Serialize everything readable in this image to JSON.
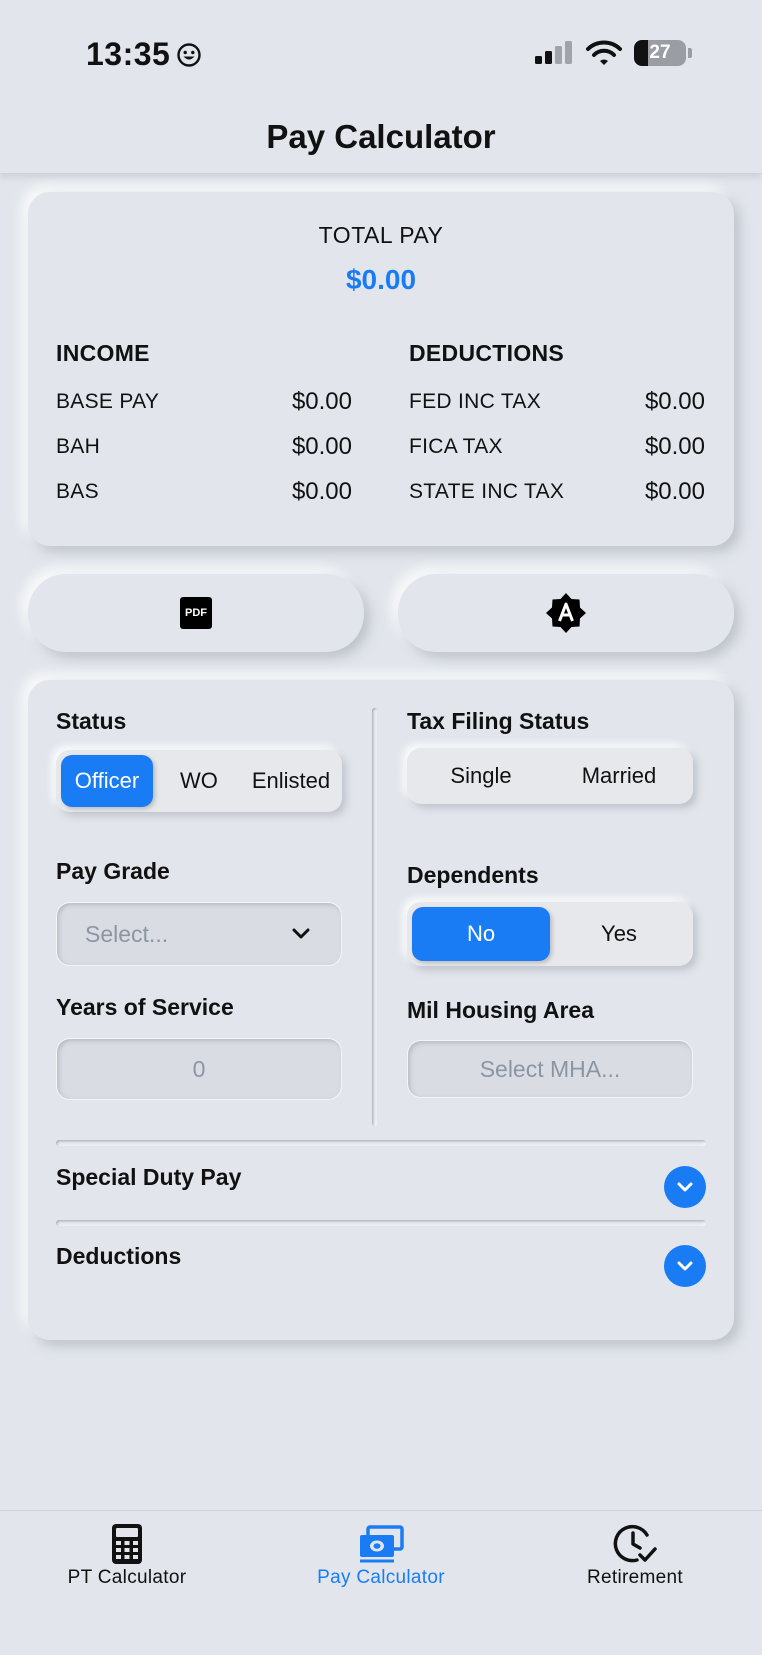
{
  "status_bar": {
    "time": "13:35",
    "battery": "27"
  },
  "header": {
    "title": "Pay Calculator"
  },
  "summary": {
    "total_label": "TOTAL PAY",
    "total_value": "$0.00",
    "income": {
      "title": "INCOME",
      "rows": [
        {
          "label": "BASE PAY",
          "value": "$0.00"
        },
        {
          "label": "BAH",
          "value": "$0.00"
        },
        {
          "label": "BAS",
          "value": "$0.00"
        }
      ]
    },
    "deductions": {
      "title": "DEDUCTIONS",
      "rows": [
        {
          "label": "FED INC TAX",
          "value": "$0.00"
        },
        {
          "label": "FICA TAX",
          "value": "$0.00"
        },
        {
          "label": "STATE INC TAX",
          "value": "$0.00"
        }
      ]
    }
  },
  "actions": {
    "pdf_label": "PDF"
  },
  "form": {
    "status": {
      "label": "Status",
      "options": [
        "Officer",
        "WO",
        "Enlisted"
      ],
      "selected": "Officer"
    },
    "pay_grade": {
      "label": "Pay Grade",
      "placeholder": "Select..."
    },
    "years": {
      "label": "Years of Service",
      "value": "0"
    },
    "tax_filing": {
      "label": "Tax Filing Status",
      "options": [
        "Single",
        "Married"
      ]
    },
    "dependents": {
      "label": "Dependents",
      "options": [
        "No",
        "Yes"
      ],
      "selected": "No"
    },
    "mha": {
      "label": "Mil Housing Area",
      "placeholder": "Select MHA..."
    },
    "special_duty": {
      "label": "Special Duty Pay"
    },
    "deductions": {
      "label": "Deductions"
    }
  },
  "tabs": [
    {
      "label": "PT Calculator",
      "icon": "calculator-icon",
      "active": false
    },
    {
      "label": "Pay Calculator",
      "icon": "money-icon",
      "active": true
    },
    {
      "label": "Retirement",
      "icon": "clock-check-icon",
      "active": false
    }
  ],
  "colors": {
    "accent": "#1a7cf5",
    "background": "#e2e6ec"
  }
}
